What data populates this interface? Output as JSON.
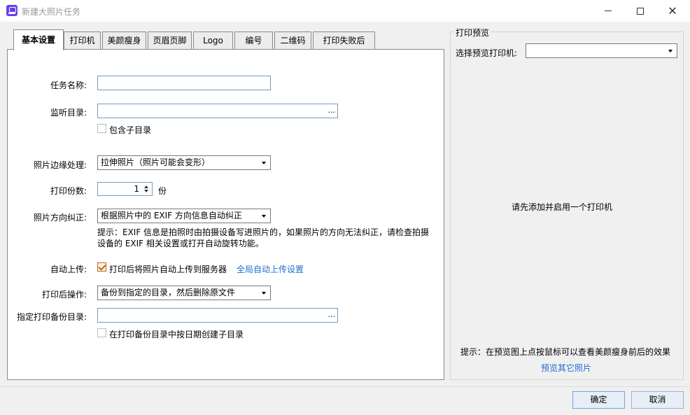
{
  "window": {
    "title": "新建大照片任务",
    "icon": "app-logo-icon"
  },
  "tabs": [
    {
      "label": "基本设置",
      "active": true
    },
    {
      "label": "打印机"
    },
    {
      "label": "美颜瘦身"
    },
    {
      "label": "页眉页脚"
    },
    {
      "label": "Logo"
    },
    {
      "label": "编号"
    },
    {
      "label": "二维码"
    },
    {
      "label": "打印失败后"
    }
  ],
  "form": {
    "task_name": {
      "label": "任务名称:",
      "value": ""
    },
    "watch_dir": {
      "label": "监听目录:",
      "value": "",
      "browse": "..."
    },
    "include_subdirs": {
      "label": "包含子目录",
      "checked": false
    },
    "edge_handling": {
      "label": "照片边缘处理:",
      "selected": "拉伸照片（照片可能会变形）"
    },
    "copies": {
      "label": "打印份数:",
      "value": "1",
      "unit": "份"
    },
    "orientation": {
      "label": "照片方向纠正:",
      "selected": "根据照片中的 EXIF 方向信息自动纠正"
    },
    "orientation_hint": {
      "line1": "提示：EXIF 信息是拍照时由拍摄设备写进照片的，如果照片的方向无法纠正，请检查拍摄",
      "line2": "设备的 EXIF 相关设置或打开自动旋转功能。"
    },
    "auto_upload": {
      "label": "自动上传:",
      "checkbox_label": "打印后将照片自动上传到服务器",
      "checked": true,
      "link": "全局自动上传设置"
    },
    "after_print": {
      "label": "打印后操作:",
      "selected": "备份到指定的目录，然后删除原文件"
    },
    "backup_dir": {
      "label": "指定打印备份目录:",
      "value": "",
      "browse": "..."
    },
    "date_subdir": {
      "label": "在打印备份目录中按日期创建子目录",
      "checked": false
    }
  },
  "preview": {
    "group_title": "打印预览",
    "printer_label": "选择预览打印机:",
    "printer_selected": "",
    "empty_message": "请先添加并启用一个打印机",
    "hint": "提示：在预览图上点按鼠标可以查看美颜瘦身前后的效果",
    "link": "预览其它照片"
  },
  "buttons": {
    "ok": "确定",
    "cancel": "取消"
  },
  "colors": {
    "link": "#1e6fd0",
    "app_icon": "#6a3ff0",
    "checkbox_checked": "#c0631c"
  }
}
